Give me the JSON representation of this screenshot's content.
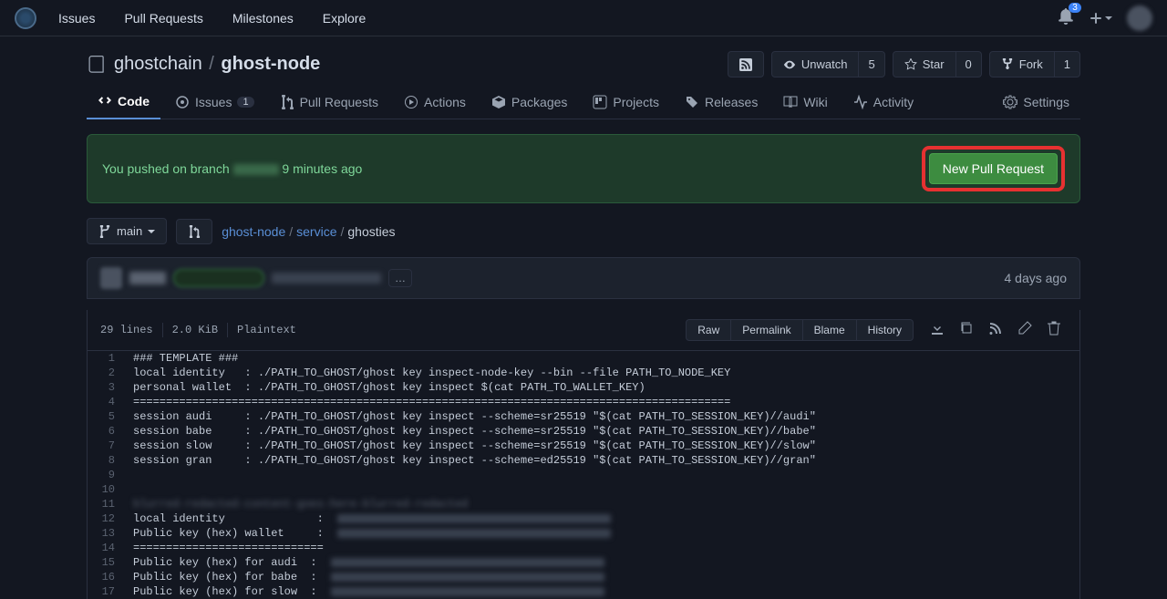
{
  "nav": {
    "items": [
      "Issues",
      "Pull Requests",
      "Milestones",
      "Explore"
    ],
    "notif_count": "3"
  },
  "repo": {
    "owner": "ghostchain",
    "name": "ghost-node",
    "actions": {
      "watch_label": "Unwatch",
      "watch_count": "5",
      "star_label": "Star",
      "star_count": "0",
      "fork_label": "Fork",
      "fork_count": "1"
    }
  },
  "tabs": {
    "code": "Code",
    "issues": "Issues",
    "issues_count": "1",
    "pr": "Pull Requests",
    "actions": "Actions",
    "packages": "Packages",
    "projects": "Projects",
    "releases": "Releases",
    "wiki": "Wiki",
    "activity": "Activity",
    "settings": "Settings"
  },
  "alert": {
    "text_prefix": "You pushed on branch ",
    "text_suffix": "9 minutes ago",
    "button": "New Pull Request"
  },
  "branch": {
    "selected": "main",
    "crumbs": {
      "root": "ghost-node",
      "mid": "service",
      "last": "ghosties"
    }
  },
  "commit": {
    "time": "4 days ago",
    "dots": "…"
  },
  "file_meta": {
    "lines": "29 lines",
    "size": "2.0 KiB",
    "type": "Plaintext",
    "raw": "Raw",
    "permalink": "Permalink",
    "blame": "Blame",
    "history": "History"
  },
  "code": [
    "### TEMPLATE ###",
    "local identity   : ./PATH_TO_GHOST/ghost key inspect-node-key --bin --file PATH_TO_NODE_KEY",
    "personal wallet  : ./PATH_TO_GHOST/ghost key inspect $(cat PATH_TO_WALLET_KEY)",
    "===========================================================================================",
    "session audi     : ./PATH_TO_GHOST/ghost key inspect --scheme=sr25519 \"$(cat PATH_TO_SESSION_KEY)//audi\"",
    "session babe     : ./PATH_TO_GHOST/ghost key inspect --scheme=sr25519 \"$(cat PATH_TO_SESSION_KEY)//babe\"",
    "session slow     : ./PATH_TO_GHOST/ghost key inspect --scheme=sr25519 \"$(cat PATH_TO_SESSION_KEY)//slow\"",
    "session gran     : ./PATH_TO_GHOST/ghost key inspect --scheme=ed25519 \"$(cat PATH_TO_SESSION_KEY)//gran\"",
    "",
    "",
    "blurred-redacted-content-goes-here-blurred-redacted",
    "local identity              : ",
    "Public key (hex) wallet     : ",
    "=============================",
    "Public key (hex) for audi  : ",
    "Public key (hex) for babe  : ",
    "Public key (hex) for slow  : "
  ]
}
